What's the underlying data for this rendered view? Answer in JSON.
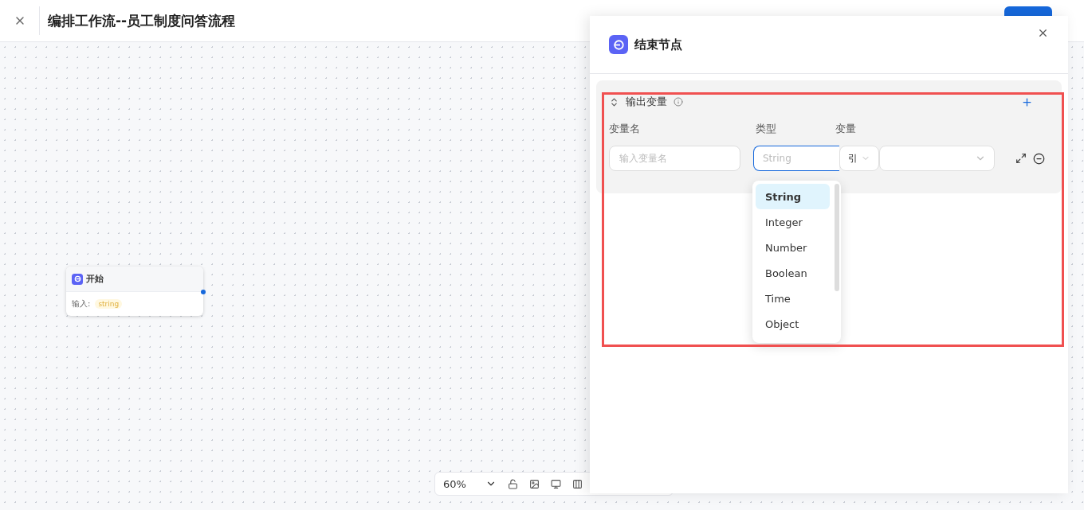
{
  "header": {
    "title": "编排工作流--员工制度问答流程"
  },
  "canvas": {
    "nodes": [
      {
        "title": "开始",
        "input_label": "输入:",
        "input_type": "string"
      }
    ],
    "toolbar": {
      "zoom": "60%"
    }
  },
  "drawer": {
    "title": "结束节点",
    "section": {
      "title": "输出变量",
      "expanded": true,
      "columns": [
        "变量名",
        "类型",
        "变量"
      ],
      "rows": [
        {
          "name_placeholder": "输入变量名",
          "type_placeholder": "String",
          "source_mode": "引"
        }
      ]
    },
    "type_menu": {
      "options": [
        {
          "label": "String",
          "selected": true
        },
        {
          "label": "Integer",
          "selected": false
        },
        {
          "label": "Number",
          "selected": false
        },
        {
          "label": "Boolean",
          "selected": false
        },
        {
          "label": "Time",
          "selected": false
        },
        {
          "label": "Object",
          "selected": false
        }
      ]
    }
  }
}
